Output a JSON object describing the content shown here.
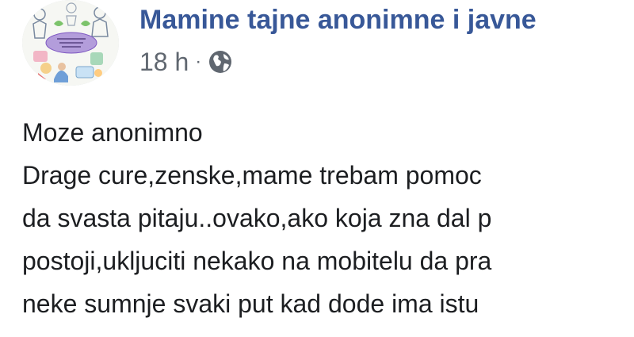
{
  "post": {
    "group_name": "Mamine tajne anonimne i javne",
    "timestamp": "18 h",
    "separator": "·",
    "privacy_icon": "globe-icon",
    "avatar_icon": "group-avatar-illustration",
    "logo_text": "Mamine tajne anonimne i javne",
    "lines": [
      "Moze anonimno",
      "Drage cure,zenske,mame trebam pomoc",
      "da svasta pitaju..ovako,ako koja zna dal p",
      "postoji,ukljuciti nekako na mobitelu da pra",
      "neke sumnje svaki put kad dode ima istu"
    ]
  },
  "colors": {
    "group_name": "#385898",
    "meta_text": "#606770",
    "body_text": "#1c1e21",
    "background": "#ffffff"
  }
}
